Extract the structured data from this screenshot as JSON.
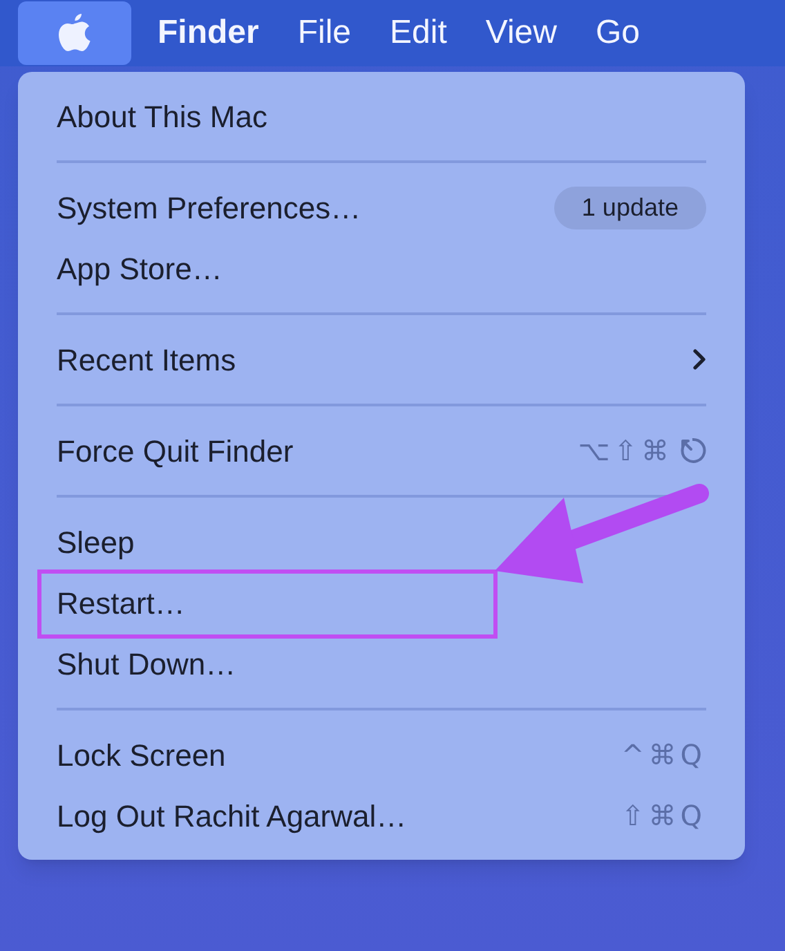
{
  "menu_bar": [
    {
      "kind": "apple",
      "selected": true
    },
    {
      "kind": "app",
      "label": "Finder",
      "selected": false
    },
    {
      "kind": "menu",
      "label": "File",
      "selected": false
    },
    {
      "kind": "menu",
      "label": "Edit",
      "selected": false
    },
    {
      "kind": "menu",
      "label": "View",
      "selected": false
    },
    {
      "kind": "menu",
      "label": "Go",
      "selected": false
    }
  ],
  "menu": {
    "sections": [
      [
        {
          "label": "About This Mac"
        }
      ],
      [
        {
          "label": "System Preferences…",
          "badge": "1 update"
        },
        {
          "label": "App Store…"
        }
      ],
      [
        {
          "label": "Recent Items",
          "submenu": true
        }
      ],
      [
        {
          "label": "Force Quit Finder",
          "shortcut": "⌥⇧⌘",
          "escape_key": true
        }
      ],
      [
        {
          "label": "Sleep"
        },
        {
          "label": "Restart…",
          "highlighted": true
        },
        {
          "label": "Shut Down…"
        }
      ],
      [
        {
          "label": "Lock Screen",
          "shortcut": "^⌘Q"
        },
        {
          "label": "Log Out Rachit Agarwal…",
          "shortcut": "⇧⌘Q"
        }
      ]
    ]
  }
}
